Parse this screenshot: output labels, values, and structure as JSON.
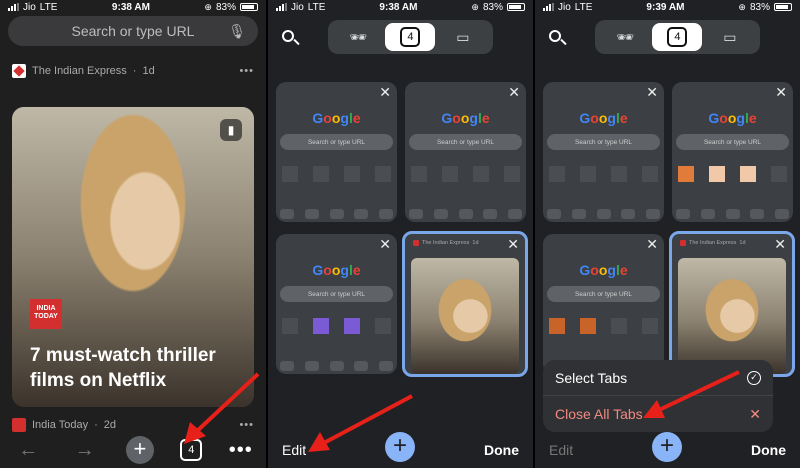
{
  "status_left": {
    "carrier": "Jio",
    "network": "LTE"
  },
  "panel1": {
    "status": {
      "time": "9:38 AM",
      "battery": "83%"
    },
    "omnibox_placeholder": "Search or type URL",
    "source1": {
      "name": "The Indian Express",
      "age": "1d"
    },
    "article": {
      "logo_text": "INDIA TODAY",
      "headline": "7 must-watch thriller films on Netflix"
    },
    "source2": {
      "name": "India Today",
      "age": "2d"
    },
    "toolbar": {
      "tab_count": "4"
    }
  },
  "panel2": {
    "status": {
      "time": "9:38 AM",
      "battery": "83%"
    },
    "tab_count": "4",
    "tab_search_placeholder": "Search or type URL",
    "google_letters": [
      "G",
      "o",
      "o",
      "g",
      "l",
      "e"
    ],
    "open_tab_source": "The Indian Express",
    "open_tab_age": "1d",
    "edit_label": "Edit",
    "done_label": "Done"
  },
  "panel3": {
    "status": {
      "time": "9:39 AM",
      "battery": "83%"
    },
    "tab_count": "4",
    "menu": {
      "select_tabs": "Select Tabs",
      "close_all": "Close All Tabs"
    },
    "edit_label": "Edit",
    "done_label": "Done"
  },
  "colors": {
    "accent": "#8ab4f8",
    "selected_border": "#7aa7e9",
    "danger": "#f28b82",
    "arrow": "#e8201a"
  }
}
